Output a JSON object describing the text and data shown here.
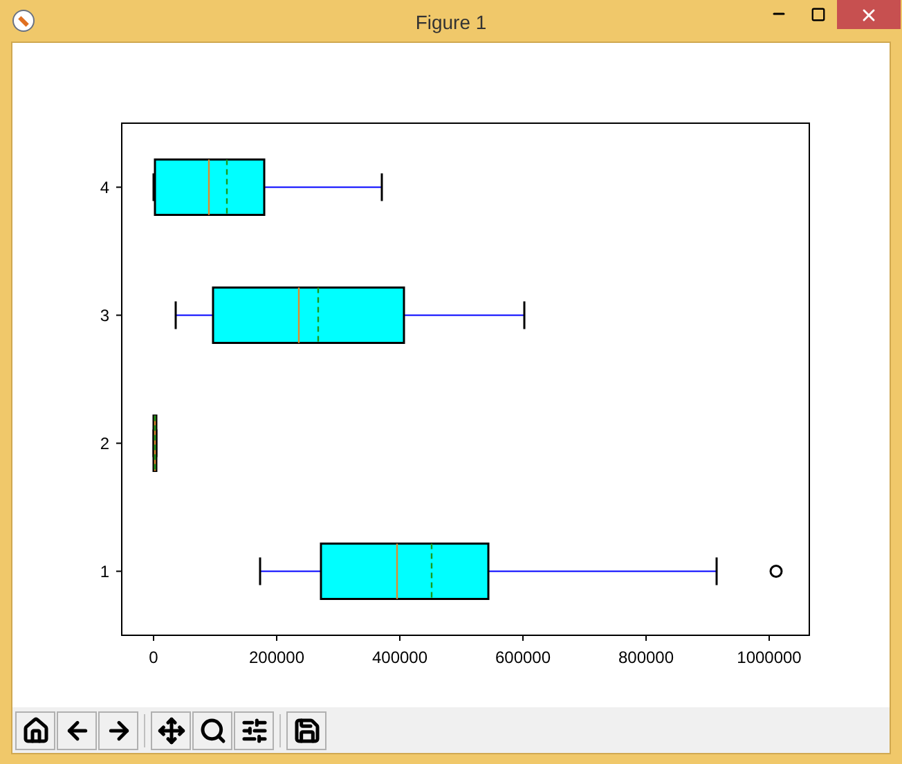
{
  "window": {
    "title": "Figure 1"
  },
  "figure": {
    "y_tick_labels": [
      "4",
      "3",
      "2",
      "1"
    ],
    "x_tick_labels": [
      "0",
      "200000",
      "400000",
      "600000",
      "800000",
      "1000000"
    ]
  }
}
